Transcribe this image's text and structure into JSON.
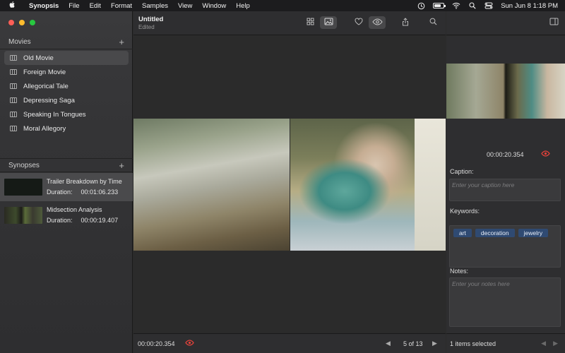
{
  "menubar": {
    "apple": "",
    "app_name": "Synopsis",
    "menus": [
      "File",
      "Edit",
      "Format",
      "Samples",
      "View",
      "Window",
      "Help"
    ],
    "clock": "Sun Jun 8  1:18 PM"
  },
  "document": {
    "title": "Untitled",
    "subtitle": "Edited"
  },
  "sidebar": {
    "movies_header": "Movies",
    "add_symbol": "+",
    "movies": [
      {
        "label": "Old Movie",
        "selected": true
      },
      {
        "label": "Foreign Movie"
      },
      {
        "label": "Allegorical Tale"
      },
      {
        "label": "Depressing Saga"
      },
      {
        "label": "Speaking In Tongues"
      },
      {
        "label": "Moral Allegory"
      }
    ],
    "synopses_header": "Synopses",
    "synopses": [
      {
        "title": "Trailer Breakdown by Time",
        "duration_label": "Duration:",
        "duration": "00:01:06.233",
        "selected": true
      },
      {
        "title": "Midsection Analysis",
        "duration_label": "Duration:",
        "duration": "00:00:19.407"
      }
    ]
  },
  "toolbar": {
    "icons": [
      "grid-view-icon",
      "image-view-icon",
      "heart-icon",
      "eye-icon",
      "share-icon",
      "search-icon",
      "sidebar-toggle-icon"
    ]
  },
  "viewer": {
    "timecode": "00:00:20.354",
    "page_indicator": "5 of 13",
    "prev_symbol": "◀",
    "next_symbol": "▶"
  },
  "inspector": {
    "timecode": "00:00:20.354",
    "caption_label": "Caption:",
    "caption_placeholder": "Enter your caption here",
    "keywords_label": "Keywords:",
    "keywords": [
      "art",
      "decoration",
      "jewelry"
    ],
    "notes_label": "Notes:",
    "notes_placeholder": "Enter your notes here",
    "footer_status": "1 items selected",
    "prev_symbol": "◀",
    "next_symbol": "▶"
  },
  "colors": {
    "accent_red": "#e0413a",
    "keyword_tag": "#2f4a72",
    "selection": "#49494b"
  }
}
